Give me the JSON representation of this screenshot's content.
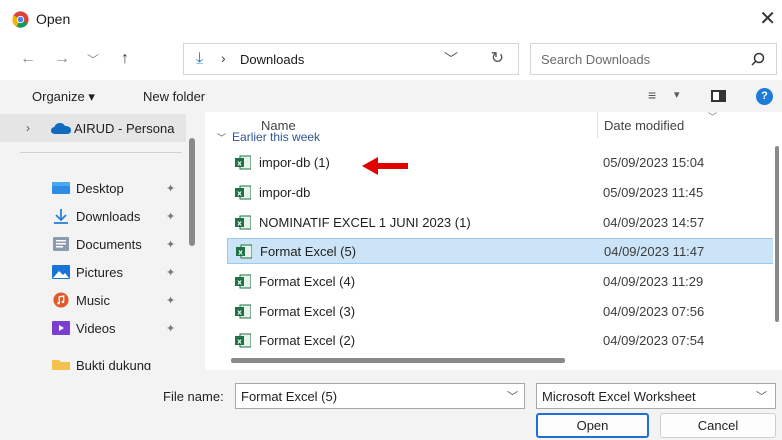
{
  "window": {
    "title": "Open",
    "close_glyph": "✕"
  },
  "nav": {
    "back_glyph": "←",
    "forward_glyph": "→",
    "recent_glyph": "﹀",
    "up_glyph": "↑",
    "path_separator": "›",
    "current_folder": "Downloads",
    "refresh_glyph": "↻",
    "dropdown_glyph": "﹀"
  },
  "search": {
    "placeholder": "Search Downloads"
  },
  "toolbar": {
    "organize_label": "Organize ▾",
    "new_folder_label": "New folder",
    "view_glyph": "≡",
    "view_dropdown_glyph": "▾",
    "help_glyph": "?"
  },
  "sidebar": {
    "onedrive_label": "AIRUD - Persona",
    "items": [
      {
        "label": "Desktop",
        "icon": "desktop-icon",
        "pin": "📌"
      },
      {
        "label": "Downloads",
        "icon": "download-icon",
        "pin": "📌"
      },
      {
        "label": "Documents",
        "icon": "documents-icon",
        "pin": "📌"
      },
      {
        "label": "Pictures",
        "icon": "pictures-icon",
        "pin": "📌"
      },
      {
        "label": "Music",
        "icon": "music-icon",
        "pin": "📌"
      },
      {
        "label": "Videos",
        "icon": "videos-icon",
        "pin": "📌"
      },
      {
        "label": "Bukti dukung",
        "icon": "folder-icon"
      }
    ]
  },
  "file_list": {
    "columns": {
      "name": "Name",
      "date_modified": "Date modified"
    },
    "group_header": "Earlier this week",
    "rows": [
      {
        "name": "impor-db (1)",
        "date": "05/09/2023 15:04",
        "selected": false
      },
      {
        "name": "impor-db",
        "date": "05/09/2023 11:45",
        "selected": false
      },
      {
        "name": "NOMINATIF EXCEL 1 JUNI 2023 (1)",
        "date": "04/09/2023 14:57",
        "selected": false
      },
      {
        "name": "Format Excel (5)",
        "date": "04/09/2023 11:47",
        "selected": true
      },
      {
        "name": "Format Excel (4)",
        "date": "04/09/2023 11:29",
        "selected": false
      },
      {
        "name": "Format Excel (3)",
        "date": "04/09/2023 07:56",
        "selected": false
      },
      {
        "name": "Format Excel (2)",
        "date": "04/09/2023 07:54",
        "selected": false
      }
    ]
  },
  "footer": {
    "file_name_label": "File name:",
    "file_name_value": "Format Excel (5)",
    "file_type_value": "Microsoft Excel Worksheet",
    "dropdown_glyph": "﹀",
    "open_label": "Open",
    "cancel_label": "Cancel"
  },
  "colors": {
    "accent": "#1e6fd9",
    "selected_row": "#cce4f7",
    "annotation_arrow": "#e00000",
    "excel_green": "#1e7145"
  }
}
